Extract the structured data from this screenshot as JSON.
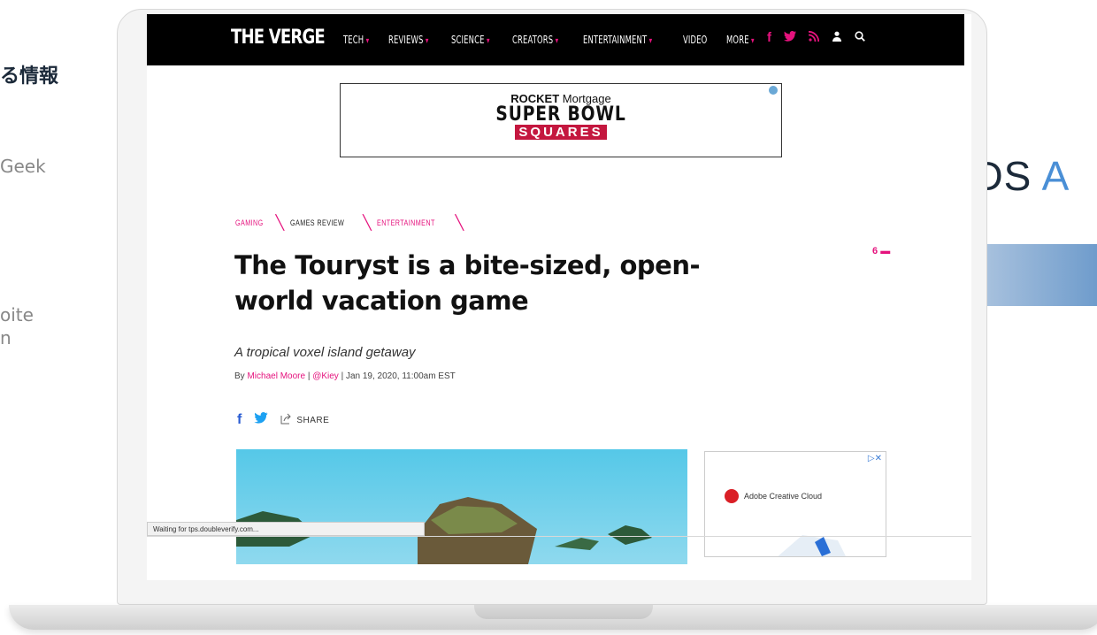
{
  "slide": {
    "left_heading": "る情報",
    "left_geek": "Geek",
    "left_bite": "oite",
    "left_n": "n",
    "teads_word": "TEADS",
    "teads_letter": "A"
  },
  "browser": {
    "nav": {
      "logo": "THE VERGE",
      "items": [
        {
          "label": "TECH",
          "caret": "▾"
        },
        {
          "label": "REVIEWS",
          "caret": "▾"
        },
        {
          "label": "SCIENCE",
          "caret": "▾"
        },
        {
          "label": "CREATORS",
          "caret": "▾"
        },
        {
          "label": "ENTERTAINMENT",
          "caret": "▾"
        },
        {
          "label": "VIDEO",
          "caret": ""
        },
        {
          "label": "MORE",
          "caret": "▾"
        }
      ],
      "icons": {
        "facebook": "f",
        "twitter": "🐦",
        "rss": "⦚",
        "user": "👤",
        "search": "⌕"
      }
    },
    "ad": {
      "line1_bold": "ROCKET",
      "line1_rest": " Mortgage",
      "line2": "SUPER BOWL",
      "line3": "SQUARES"
    },
    "article": {
      "breadcrumbs": [
        "GAMING",
        "GAMES REVIEW",
        "ENTERTAINMENT"
      ],
      "comments": "6",
      "title": "The Touryst is a bite-sized, open-world vacation game",
      "subtitle": "A tropical voxel island getaway",
      "byline_prefix": "By ",
      "author": "Michael Moore",
      "byline_sep": " | ",
      "handle": "@Kiey",
      "date": "  |  Jan 19, 2020, 11:00am EST",
      "share_label": "SHARE"
    },
    "side_ad": {
      "adchoice": "▷✕",
      "brand": "Adobe Creative Cloud"
    },
    "status": "Waiting for tps.doubleverify.com..."
  }
}
